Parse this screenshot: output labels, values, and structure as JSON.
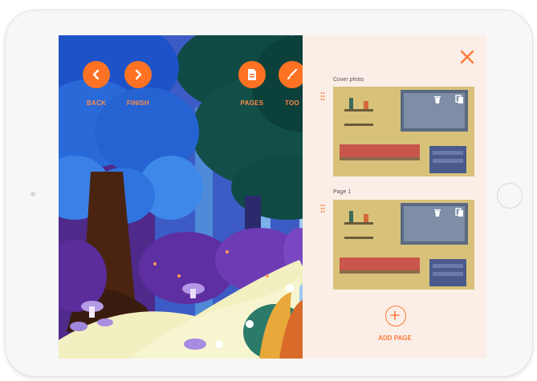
{
  "toolbar": {
    "back_label": "BACK",
    "finish_label": "FINISH",
    "pages_label": "PAGES",
    "tools_label": "TOO"
  },
  "panel": {
    "pages": [
      {
        "label": "Cover photo"
      },
      {
        "label": "Page 1"
      }
    ],
    "add_page_label": "ADD PAGE"
  },
  "colors": {
    "accent": "#ff7224",
    "panel_bg": "#fbeee7"
  },
  "icons": [
    "chevron-left-icon",
    "chevron-right-icon",
    "pages-icon",
    "brush-icon",
    "close-icon",
    "drag-handle-icon",
    "trash-icon",
    "copy-icon",
    "plus-icon"
  ]
}
